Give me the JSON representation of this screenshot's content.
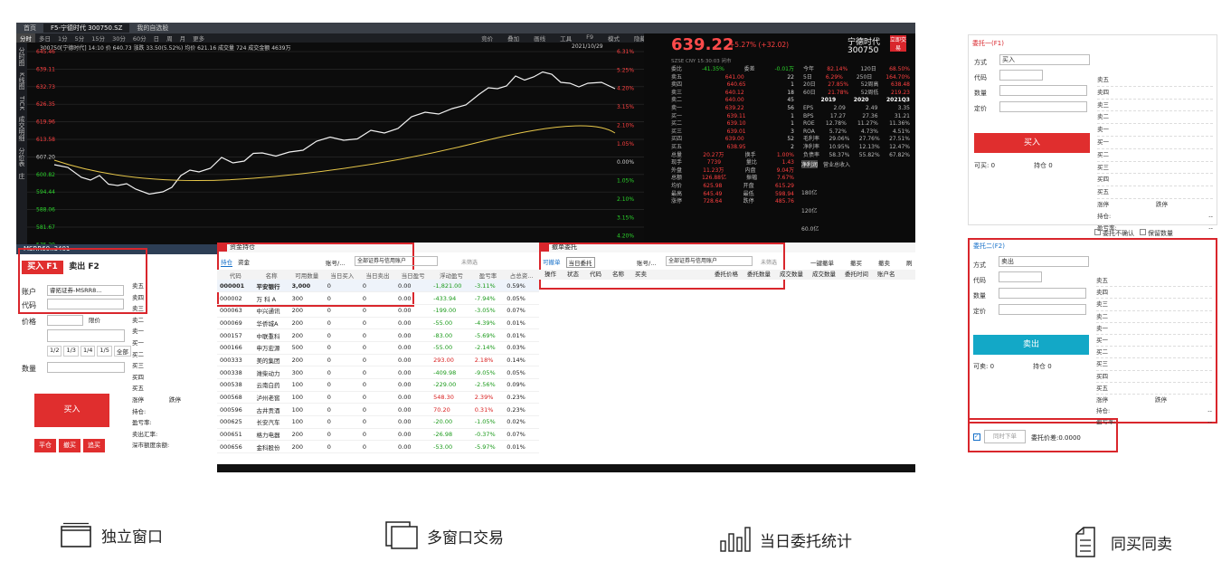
{
  "tabs": [
    "首页",
    "F5-宁德时代 300750.SZ",
    "我的自选股"
  ],
  "period_tabs": [
    "分时",
    "多日",
    "1分",
    "5分",
    "15分",
    "30分",
    "60分",
    "日",
    "周",
    "月",
    "更多"
  ],
  "chart_header": "300750[宁德时代] 14:10 价 640.73 涨跌 33.50(5.52%) 均价 621.16 成交量 724 成交金额 4639万",
  "chart_date": "2021/10/29",
  "toolbar_right": [
    "竞价",
    "叠加",
    "画线",
    "工具",
    "F9",
    "模式",
    "隐藏"
  ],
  "y_labels": [
    "645.46",
    "639.11",
    "632.73",
    "626.35",
    "619.96",
    "613.58",
    "607.20",
    "600.82",
    "594.44",
    "588.06",
    "581.67",
    "575.29"
  ],
  "pct_labels": [
    "6.31%",
    "5.25%",
    "4.20%",
    "3.15%",
    "2.10%",
    "1.05%",
    "0.00%",
    "1.05%",
    "2.10%",
    "3.15%",
    "4.20%"
  ],
  "side_menu": [
    "分时图",
    "K线图",
    "TICK",
    "成交明细",
    "分价表",
    "庄"
  ],
  "quote": {
    "price": "639.22",
    "change": "+5.27% (+32.02)",
    "name": "宁德时代",
    "code": "300750",
    "tag": "立即交易",
    "market": "SZSE CNY 15:30:03 闭市",
    "ratio": [
      "委比",
      "-41.35%",
      "委差",
      "-0.01万"
    ],
    "sell": [
      [
        "卖五",
        "641.00",
        "22"
      ],
      [
        "卖四",
        "640.65",
        "1"
      ],
      [
        "卖三",
        "640.12",
        "18"
      ],
      [
        "卖二",
        "640.00",
        "45"
      ],
      [
        "卖一",
        "639.22",
        "56"
      ]
    ],
    "buy": [
      [
        "买一",
        "639.11",
        "1"
      ],
      [
        "买二",
        "639.10",
        "1"
      ],
      [
        "买三",
        "639.01",
        "3"
      ],
      [
        "买四",
        "639.00",
        "52"
      ],
      [
        "买五",
        "638.95",
        "2"
      ]
    ],
    "stats": [
      [
        "总量",
        "20.27万",
        "换手",
        "1.00%"
      ],
      [
        "现手",
        "7739",
        "量比",
        "1.43"
      ],
      [
        "外盘",
        "11.23万",
        "内盘",
        "9.04万"
      ],
      [
        "总额",
        "126.88亿",
        "振幅",
        "7.67%"
      ],
      [
        "均价",
        "625.98",
        "开盘",
        "615.29"
      ],
      [
        "最高",
        "645.49",
        "最低",
        "598.94"
      ],
      [
        "涨停",
        "728.64",
        "跌停",
        "485.76"
      ]
    ],
    "perf": [
      [
        "今年",
        "82.14%",
        "120日",
        "68.50%"
      ],
      [
        "5日",
        "6.29%",
        "250日",
        "164.70%"
      ],
      [
        "20日",
        "27.85%",
        "52周高",
        "638.48"
      ],
      [
        "60日",
        "21.78%",
        "52周低",
        "219.23"
      ]
    ],
    "fin_head": [
      "",
      "2019",
      "2020",
      "2021Q3"
    ],
    "fin": [
      [
        "EPS",
        "2.09",
        "2.49",
        "3.35"
      ],
      [
        "BPS",
        "17.27",
        "27.36",
        "31.21"
      ],
      [
        "ROE",
        "12.78%",
        "11.27%",
        "11.36%"
      ],
      [
        "ROA",
        "5.72%",
        "4.73%",
        "4.51%"
      ],
      [
        "毛利率",
        "29.06%",
        "27.76%",
        "27.51%"
      ],
      [
        "净利率",
        "10.95%",
        "12.13%",
        "12.47%"
      ],
      [
        "负债率",
        "58.37%",
        "55.82%",
        "67.82%"
      ]
    ],
    "tabs": [
      "净利润",
      "营业总收入"
    ],
    "bars_y": [
      "180亿",
      "120亿",
      "60.0亿"
    ]
  },
  "order_panel": {
    "account_title": "MSRR60..3401",
    "buy_tab": "买入 F1",
    "sell_tab": "卖出 F2",
    "labels": [
      "账户",
      "代码",
      "价格",
      "数量"
    ],
    "account_value": "睿拓证券-MSRR8...",
    "price_mode": "限价",
    "fractions": [
      "1/2",
      "1/3",
      "1/4",
      "1/5",
      "全部"
    ],
    "levels": [
      "卖五",
      "卖四",
      "卖三",
      "卖二",
      "卖一",
      "买一",
      "买二",
      "买三",
      "买四",
      "买五"
    ],
    "bottom": [
      "涨停",
      "跌停",
      "持仓:",
      "盈亏率:",
      "卖出汇率:",
      "深市额度余额:"
    ],
    "buy_btn": "买入",
    "small_btns": [
      "平仓",
      "撤买",
      "追买"
    ]
  },
  "holdings": {
    "title": "资金持仓",
    "tabs": [
      "持仓",
      "资金"
    ],
    "acct_label": "账号/...",
    "acct_value": "全部证券与信用账户",
    "filter": "未筛选",
    "headers": [
      "代码",
      "名称",
      "可用数量",
      "当日买入",
      "当日卖出",
      "当日盈亏",
      "浮动盈亏",
      "盈亏率",
      "占总资..."
    ],
    "rows": [
      [
        "000001",
        "平安银行",
        "3,000",
        "0",
        "0",
        "0.00",
        "-1,821.00",
        "-3.11%",
        "0.59%"
      ],
      [
        "000002",
        "万 科 A",
        "300",
        "0",
        "0",
        "0.00",
        "-433.94",
        "-7.94%",
        "0.05%"
      ],
      [
        "000063",
        "中兴通讯",
        "200",
        "0",
        "0",
        "0.00",
        "-199.00",
        "-3.05%",
        "0.07%"
      ],
      [
        "000069",
        "华侨城A",
        "200",
        "0",
        "0",
        "0.00",
        "-55.00",
        "-4.39%",
        "0.01%"
      ],
      [
        "000157",
        "中联重科",
        "200",
        "0",
        "0",
        "0.00",
        "-83.00",
        "-5.69%",
        "0.01%"
      ],
      [
        "000166",
        "申万宏源",
        "500",
        "0",
        "0",
        "0.00",
        "-55.00",
        "-2.14%",
        "0.03%"
      ],
      [
        "000333",
        "美的集团",
        "200",
        "0",
        "0",
        "0.00",
        "293.00",
        "2.18%",
        "0.14%"
      ],
      [
        "000338",
        "潍柴动力",
        "300",
        "0",
        "0",
        "0.00",
        "-409.98",
        "-9.05%",
        "0.05%"
      ],
      [
        "000538",
        "云南白药",
        "100",
        "0",
        "0",
        "0.00",
        "-229.00",
        "-2.56%",
        "0.09%"
      ],
      [
        "000568",
        "泸州老窖",
        "100",
        "0",
        "0",
        "0.00",
        "548.30",
        "2.39%",
        "0.23%"
      ],
      [
        "000596",
        "古井贡酒",
        "100",
        "0",
        "0",
        "0.00",
        "70.20",
        "0.31%",
        "0.23%"
      ],
      [
        "000625",
        "长安汽车",
        "100",
        "0",
        "0",
        "0.00",
        "-20.00",
        "-1.05%",
        "0.02%"
      ],
      [
        "000651",
        "格力电器",
        "200",
        "0",
        "0",
        "0.00",
        "-26.98",
        "-0.37%",
        "0.07%"
      ],
      [
        "000656",
        "金科股份",
        "200",
        "0",
        "0",
        "0.00",
        "-53.00",
        "-5.97%",
        "0.01%"
      ]
    ]
  },
  "orders": {
    "title": "撤单委托",
    "tabs": [
      "可撤单",
      "当日委托"
    ],
    "acct_label": "账号/...",
    "acct_value": "全部证券与信用账户",
    "filter": "未筛选",
    "actions": [
      "一键撤单",
      "撤买",
      "撤卖",
      "刷"
    ],
    "headers_left": [
      "操作",
      "状态",
      "代码",
      "名称",
      "买卖"
    ],
    "headers_right": [
      "委托价格",
      "委托数量",
      "成交数量",
      "成交数量",
      "委托时间",
      "账户名"
    ]
  },
  "form1": {
    "title": "委托一(F1)",
    "labels": [
      "方式",
      "代码",
      "数量",
      "定价"
    ],
    "mode": "买入",
    "btn": "买入",
    "can": "可买:",
    "can_val": "0",
    "hold": "持仓",
    "hold_val": "0",
    "levels": [
      "卖五",
      "卖四",
      "卖三",
      "卖二",
      "卖一",
      "买一",
      "买二",
      "买三",
      "买四",
      "买五"
    ],
    "limits": [
      "涨停",
      "跌停"
    ],
    "extra": [
      "持仓:",
      "盈亏率:"
    ],
    "dash": "--",
    "checks": [
      "委托不确认",
      "保留数量"
    ]
  },
  "form2": {
    "title": "委托二(F2)",
    "labels": [
      "方式",
      "代码",
      "数量",
      "定价"
    ],
    "mode": "卖出",
    "btn": "卖出",
    "can": "可卖:",
    "can_val": "0",
    "hold": "持仓",
    "hold_val": "0",
    "levels": [
      "卖五",
      "卖四",
      "卖三",
      "卖二",
      "卖一",
      "买一",
      "买二",
      "买三",
      "买四",
      "买五"
    ],
    "limits": [
      "涨停",
      "跌停"
    ],
    "extra": [
      "持仓:",
      "盈亏率:"
    ],
    "dash": "--",
    "sync_btn": "同时下单",
    "diff": "委托价差:0.0000"
  },
  "features": [
    "独立窗口",
    "多窗口交易",
    "当日委托统计",
    "同买同卖"
  ],
  "colors": {
    "red": "#d9262c",
    "blue": "#13a8c7",
    "up": "#ff4040",
    "down": "#2bd42b"
  }
}
